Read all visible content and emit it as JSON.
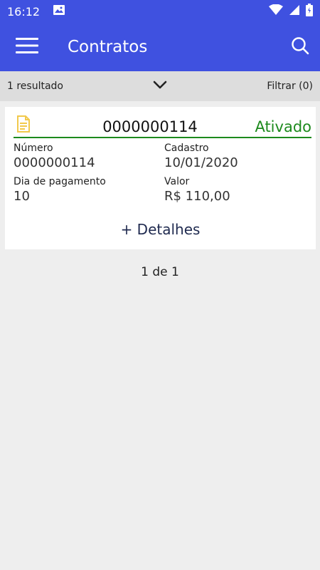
{
  "status_bar": {
    "time": "16:12",
    "icons": [
      "image-icon",
      "wifi-icon",
      "signal-icon",
      "battery-icon"
    ]
  },
  "app_bar": {
    "title": "Contratos",
    "menu_icon": "hamburger-icon",
    "search_icon": "search-icon",
    "color": "#3f51e0"
  },
  "filter_bar": {
    "result_count": "1 resultado",
    "filter_label": "Filtrar (0)"
  },
  "contract_card": {
    "number": "0000000114",
    "status": "Ativado",
    "status_color": "#1d8a1d",
    "fields": {
      "numero_label": "Número",
      "numero_value": "0000000114",
      "cadastro_label": "Cadastro",
      "cadastro_value": "10/01/2020",
      "dia_label": "Dia de pagamento",
      "dia_value": "10",
      "valor_label": "Valor",
      "valor_value": "R$ 110,00"
    },
    "details_link": "+ Detalhes"
  },
  "pagination": {
    "text": "1 de 1"
  }
}
